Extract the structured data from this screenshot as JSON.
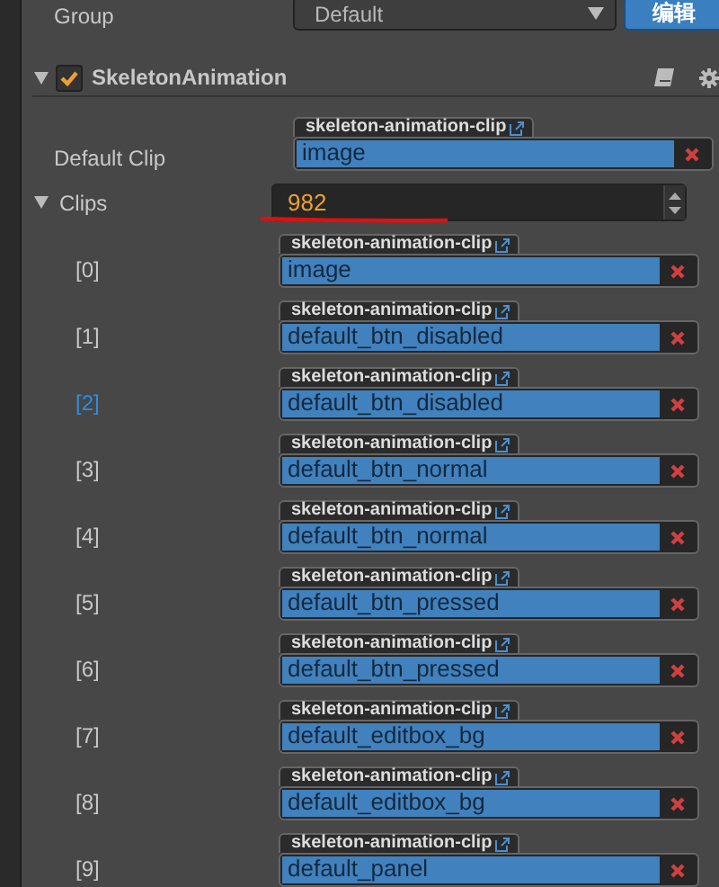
{
  "group": {
    "label": "Group",
    "value": "Default",
    "edit_button": "编辑"
  },
  "component": {
    "name": "SkeletonAnimation",
    "expanded": true,
    "enabled": true,
    "default_clip": {
      "label": "Default Clip",
      "tag": "skeleton-animation-clip",
      "value": "image"
    },
    "clips": {
      "label": "Clips",
      "expanded": true,
      "count": "982",
      "items": [
        {
          "index": "[0]",
          "tag": "skeleton-animation-clip",
          "value": "image",
          "selected": false
        },
        {
          "index": "[1]",
          "tag": "skeleton-animation-clip",
          "value": "default_btn_disabled",
          "selected": false
        },
        {
          "index": "[2]",
          "tag": "skeleton-animation-clip",
          "value": "default_btn_disabled",
          "selected": true
        },
        {
          "index": "[3]",
          "tag": "skeleton-animation-clip",
          "value": "default_btn_normal",
          "selected": false
        },
        {
          "index": "[4]",
          "tag": "skeleton-animation-clip",
          "value": "default_btn_normal",
          "selected": false
        },
        {
          "index": "[5]",
          "tag": "skeleton-animation-clip",
          "value": "default_btn_pressed",
          "selected": false
        },
        {
          "index": "[6]",
          "tag": "skeleton-animation-clip",
          "value": "default_btn_pressed",
          "selected": false
        },
        {
          "index": "[7]",
          "tag": "skeleton-animation-clip",
          "value": "default_editbox_bg",
          "selected": false
        },
        {
          "index": "[8]",
          "tag": "skeleton-animation-clip",
          "value": "default_editbox_bg",
          "selected": false
        },
        {
          "index": "[9]",
          "tag": "skeleton-animation-clip",
          "value": "default_panel",
          "selected": false
        }
      ]
    }
  }
}
